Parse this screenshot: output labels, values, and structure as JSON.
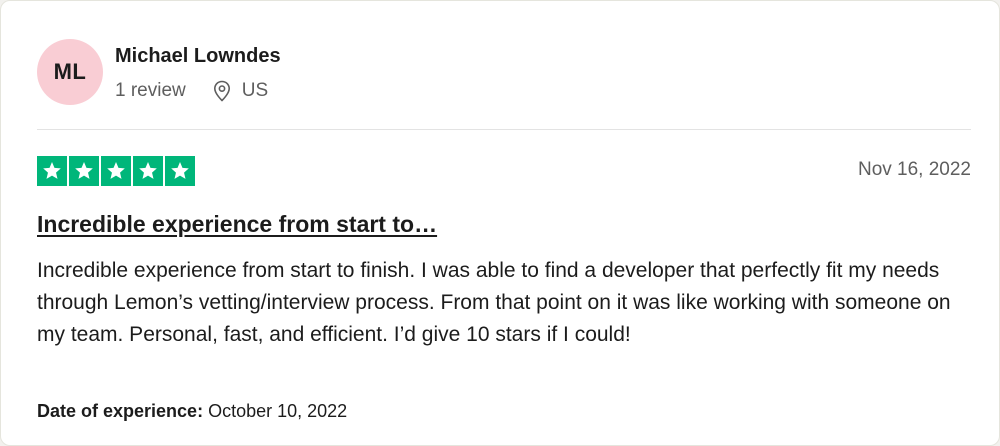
{
  "reviewer": {
    "initials": "ML",
    "name": "Michael Lowndes",
    "review_count": "1 review",
    "location": "US"
  },
  "review": {
    "rating": 5,
    "rating_max": 5,
    "date": "Nov 16, 2022",
    "title": "Incredible experience from start to…",
    "body": "Incredible experience from start to finish. I was able to find a developer that perfectly fit my needs through Lemon’s vetting/interview process. From that point on it was like working with someone on my team. Personal, fast, and efficient. I’d give 10 stars if I could!",
    "experience_label": "Date of experience:",
    "experience_date": "October 10, 2022"
  },
  "icons": {
    "location": "map-pin-icon",
    "star": "star-icon"
  },
  "colors": {
    "star_background": "#00b67a",
    "avatar_background": "#f9cdd4",
    "text_primary": "#1c1c1c",
    "text_secondary": "#5e5e5e"
  }
}
